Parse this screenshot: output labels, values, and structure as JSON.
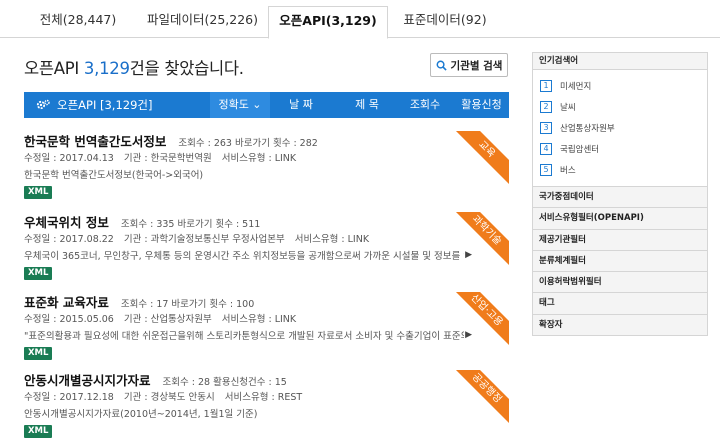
{
  "tabs": [
    {
      "label": "전체(28,447)"
    },
    {
      "label": "파일데이터(25,226)"
    },
    {
      "label": "오픈API(3,129)"
    },
    {
      "label": "표준데이터(92)"
    }
  ],
  "heading": {
    "prefix": "오픈API ",
    "count": "3,129",
    "suffix": "건을 찾았습니다."
  },
  "inst_search_label": "기관별 검색",
  "bar": {
    "title": "오픈API [3,129건]",
    "sorts": [
      {
        "label": "정확도 ⌄"
      },
      {
        "label": "날  짜"
      },
      {
        "label": "제  목"
      },
      {
        "label": "조회수"
      },
      {
        "label": "활용신청"
      }
    ]
  },
  "results": [
    {
      "title": "한국문학 번역출간도서정보",
      "stats": "조회수 : 263    바로가기 횟수 : 282",
      "date": "수정일 : 2017.04.13",
      "org": "기관 : 한국문학번역원",
      "service": "서비스유형 : LINK",
      "desc": "한국문학 번역출간도서정보(한국어->외국어)",
      "badge": "XML",
      "ribbon": "교육",
      "arrow": ""
    },
    {
      "title": "우체국위치 정보",
      "stats": "조회수 : 335    바로가기 횟수 : 511",
      "date": "수정일 : 2017.08.22",
      "org": "기관 : 과학기술정보통신부 우정사업본부",
      "service": "서비스유형 : LINK",
      "desc": "우체국이 365코너, 무인창구, 우체통 등의 운영시간 주소 위치정보등을 공개함으로써 가까운 시설물 및 정보를 안내하여 ...",
      "badge": "XML",
      "ribbon": "과학기술",
      "arrow": "▶"
    },
    {
      "title": "표준화 교육자료",
      "stats": "조회수 : 17    바로가기 횟수 : 100",
      "date": "수정일 : 2015.05.06",
      "org": "기관 : 산업통상자원부",
      "service": "서비스유형 : LINK",
      "desc": "\"표준의활용과 필요성에 대한 쉬운접근을위해 스토리카툰형식으로 개발된 자료로서 소비자 및 수출기업이 표준의 중요성에 ...",
      "badge": "XML",
      "ribbon": "산업·고용",
      "arrow": "▶"
    },
    {
      "title": "안동시개별공시지가자료",
      "stats": "조회수 : 28    활용신청건수 : 15",
      "date": "수정일 : 2017.12.18",
      "org": "기관 : 경상북도 안동시",
      "service": "서비스유형 : REST",
      "desc": "안동시개별공시지가자료(2010년~2014년, 1월1일 기준)",
      "badge": "XML",
      "ribbon": "공공행정",
      "arrow": ""
    }
  ],
  "sidebar": {
    "popular_title": "인기검색어",
    "popular": [
      {
        "num": "1",
        "label": "미세먼지"
      },
      {
        "num": "2",
        "label": "날씨"
      },
      {
        "num": "3",
        "label": "산업통상자원부"
      },
      {
        "num": "4",
        "label": "국립암센터"
      },
      {
        "num": "5",
        "label": "버스"
      }
    ],
    "links": [
      {
        "label": "국가중점데이터"
      },
      {
        "label": "서비스유형필터(OPENAPI)"
      },
      {
        "label": "제공기관필터"
      },
      {
        "label": "분류체계필터"
      },
      {
        "label": "이용허락범위필터"
      },
      {
        "label": "태그"
      },
      {
        "label": "확장자"
      }
    ]
  },
  "colors": {
    "primary": "#1b7ad1",
    "ribbon": "#f07c1b",
    "badge": "#1a7c54"
  }
}
